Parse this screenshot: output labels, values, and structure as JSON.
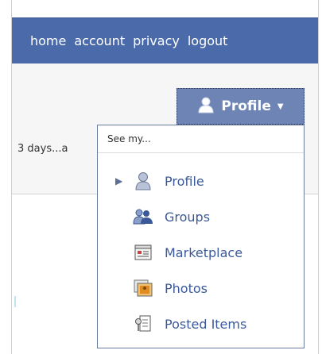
{
  "nav": {
    "items": [
      "home",
      "account",
      "privacy",
      "logout"
    ]
  },
  "snippet": "3 days...a",
  "profile_button": {
    "label": "Profile",
    "caret": "▼"
  },
  "dropdown": {
    "header": "See my...",
    "items": [
      {
        "label": "Profile",
        "icon": "person-icon",
        "selected": true
      },
      {
        "label": "Groups",
        "icon": "group-icon"
      },
      {
        "label": "Marketplace",
        "icon": "marketplace-icon"
      },
      {
        "label": "Photos",
        "icon": "photos-icon"
      },
      {
        "label": "Posted Items",
        "icon": "posted-items-icon"
      }
    ]
  },
  "colors": {
    "top_bar": "#4a6aaa",
    "button": "#6d84b4",
    "link": "#3b5998"
  }
}
